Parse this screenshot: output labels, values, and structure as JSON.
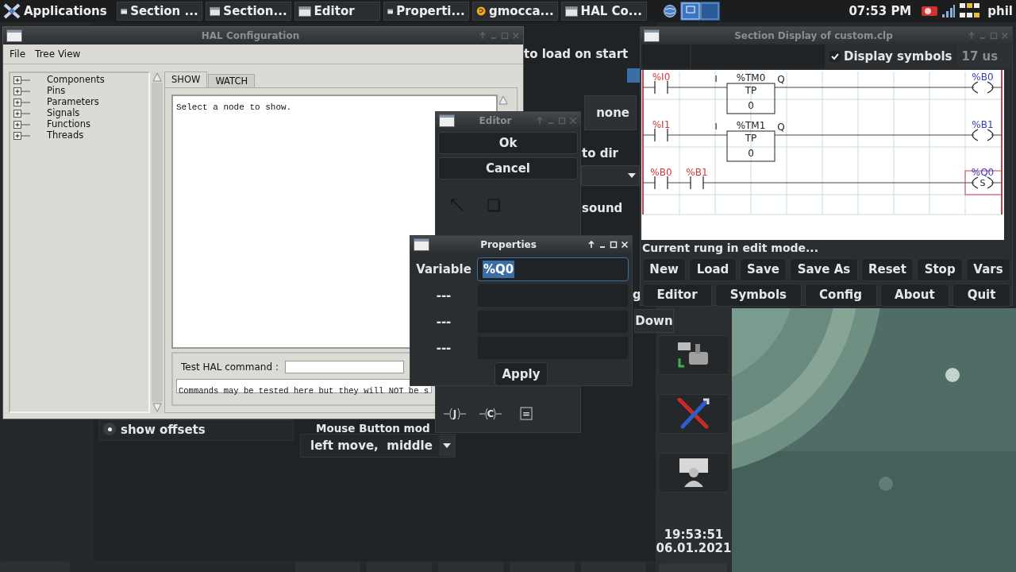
{
  "taskbar": {
    "menu": "Applications",
    "tasks": [
      {
        "label": "Section ...",
        "kind": "window"
      },
      {
        "label": "Section...",
        "kind": "window"
      },
      {
        "label": "Editor",
        "kind": "window"
      },
      {
        "label": "Properti...",
        "kind": "window"
      },
      {
        "label": "gmocca...",
        "kind": "app"
      },
      {
        "label": "HAL Co...",
        "kind": "window"
      }
    ],
    "clock": "07:53 PM",
    "user": "phil"
  },
  "background_app": {
    "load_label": "to load on start",
    "none_button": "none",
    "dir_label": "to dir",
    "sound_label": "sound",
    "cut_label": "g",
    "down_button": "Down",
    "show_offsets": {
      "label": "show offsets",
      "selected": true
    },
    "mouse_mode": {
      "label": "Mouse Button mod",
      "value": "left move,  middle"
    },
    "clock": {
      "time": "19:53:51",
      "date": "06.01.2021"
    }
  },
  "hal_window": {
    "title": "HAL Configuration",
    "active": false,
    "menu": [
      "File",
      "Tree View"
    ],
    "tree": [
      {
        "label": "Components",
        "expanded": false
      },
      {
        "label": "Pins",
        "expanded": false
      },
      {
        "label": "Parameters",
        "expanded": false
      },
      {
        "label": "Signals",
        "expanded": false
      },
      {
        "label": "Functions",
        "expanded": false
      },
      {
        "label": "Threads",
        "expanded": false
      }
    ],
    "tabs": [
      {
        "label": "SHOW",
        "selected": true
      },
      {
        "label": "WATCH",
        "selected": false
      }
    ],
    "output": "Select a node to show.",
    "command": {
      "label": "Test HAL command :",
      "note": "Commands may be tested here but they will NOT be s"
    }
  },
  "editor_window": {
    "title": "Editor",
    "active": false,
    "buttons": [
      "Ok",
      "Cancel"
    ],
    "tools": [
      {
        "kind": "pointer"
      },
      {
        "kind": "block"
      }
    ],
    "coil_tools": [
      {
        "kind": "coil",
        "symbol": "J"
      },
      {
        "kind": "coil",
        "symbol": "C"
      },
      {
        "kind": "compare",
        "symbol": "="
      }
    ]
  },
  "properties_window": {
    "title": "Properties",
    "active": true,
    "fields": [
      {
        "label": "Variable",
        "value": "%Q0",
        "text_selected": true
      },
      {
        "label": "---"
      },
      {
        "label": "---"
      },
      {
        "label": "---"
      }
    ],
    "apply": "Apply"
  },
  "section_window": {
    "title": "Section Display of custom.clp",
    "active": false,
    "display_symbols": {
      "label": "Display symbols",
      "checked": true
    },
    "scan_time": "17 us",
    "ladder": {
      "rungs": [
        {
          "elements": [
            {
              "kind": "contact",
              "label": "%I0"
            },
            {
              "kind": "timer",
              "label": "%TM0",
              "mode": "TP",
              "preset": "0",
              "input": "I",
              "output": "Q"
            },
            {
              "kind": "coil",
              "label": "%B0",
              "selected": false
            }
          ]
        },
        {
          "elements": [
            {
              "kind": "contact",
              "label": "%I1"
            },
            {
              "kind": "timer",
              "label": "%TM1",
              "mode": "TP",
              "preset": "0",
              "input": "I",
              "output": "Q"
            },
            {
              "kind": "coil",
              "label": "%B1",
              "selected": false
            }
          ]
        },
        {
          "elements": [
            {
              "kind": "contact",
              "label": "%B0"
            },
            {
              "kind": "contact",
              "label": "%B1"
            },
            {
              "kind": "coil",
              "label": "%Q0",
              "symbol": "S",
              "selected": true
            }
          ]
        }
      ]
    },
    "status": "Current rung in edit mode...",
    "buttons": [
      [
        "New",
        "Load",
        "Save",
        "Save As",
        "Reset",
        "Stop",
        "Vars"
      ],
      [
        "Editor",
        "Symbols",
        "Config",
        "About",
        "Quit"
      ]
    ]
  }
}
